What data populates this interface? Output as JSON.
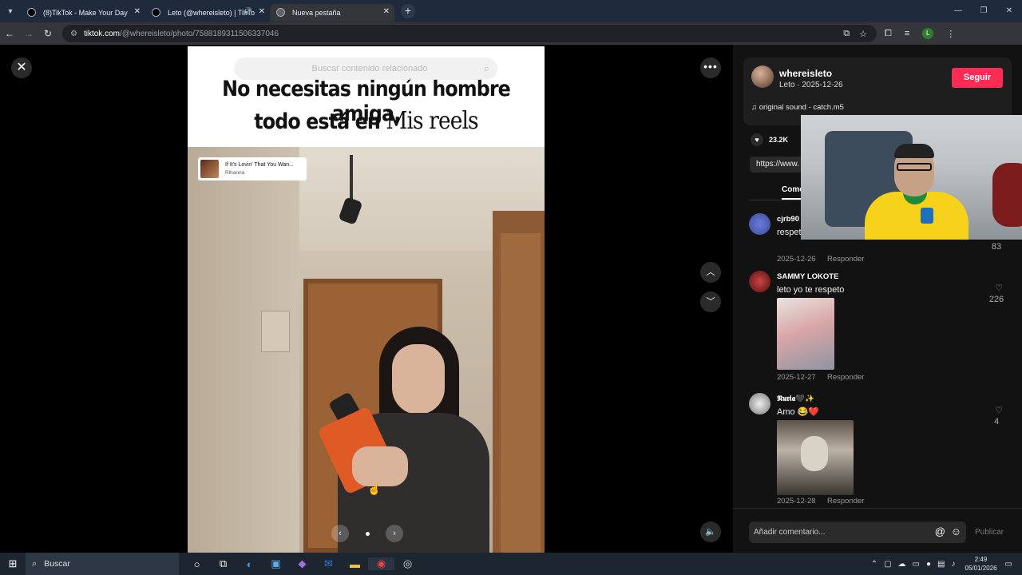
{
  "browser": {
    "tabs": [
      {
        "title": "(8)TikTok - Make Your Day",
        "active": false
      },
      {
        "title": "Leto (@whereisleto) | TikTo",
        "active": false,
        "audio": true
      },
      {
        "title": "Nueva pestaña",
        "active": true
      }
    ],
    "url_host": "tiktok.com",
    "url_path": "/@whereisleto/photo/7588189311506337046",
    "profile_initial": "L"
  },
  "viewer": {
    "search_placeholder": "Buscar contenido relacionado",
    "caption_line1": "No necesitas ningún hombre amiga,",
    "caption_line2_a": "todo está en ",
    "caption_line2_b": "Mis reels",
    "music_title": "If It's Lovin' That You Wan...",
    "music_artist": "Rihanna",
    "carousel_index": 1,
    "carousel_total": 1
  },
  "sidebar": {
    "username": "whereisleto",
    "subtitle": "Leto · 2025-12-26",
    "follow_label": "Seguir",
    "sound": "original sound - catch.m5",
    "like_count": "23.2K",
    "link_text": "https://www.",
    "tab_label": "Come",
    "composer_placeholder": "Añadir comentario...",
    "publish_label": "Publicar",
    "comments": [
      {
        "user": "cjrb90",
        "text": "respet letonia",
        "date": "2025-12-26",
        "reply": "Responder",
        "likes": "83"
      },
      {
        "user": "SAMMY LOKOTE",
        "text": "leto yo te respeto",
        "date": "2025-12-27",
        "reply": "Responder",
        "likes": "226"
      },
      {
        "user": "𝕹𝖚𝖗𝖎𝖆🖤✨",
        "text": "Amo 😂❤️",
        "date": "2025-12-28",
        "reply": "Responder",
        "likes": "4"
      }
    ]
  },
  "taskbar": {
    "search_label": "Buscar",
    "time": "2:49",
    "date": "05/01/2026"
  },
  "colors": {
    "accent": "#fe2c55",
    "sidebar_bg": "#121212",
    "tabbar_bg": "#1f2b3d"
  }
}
